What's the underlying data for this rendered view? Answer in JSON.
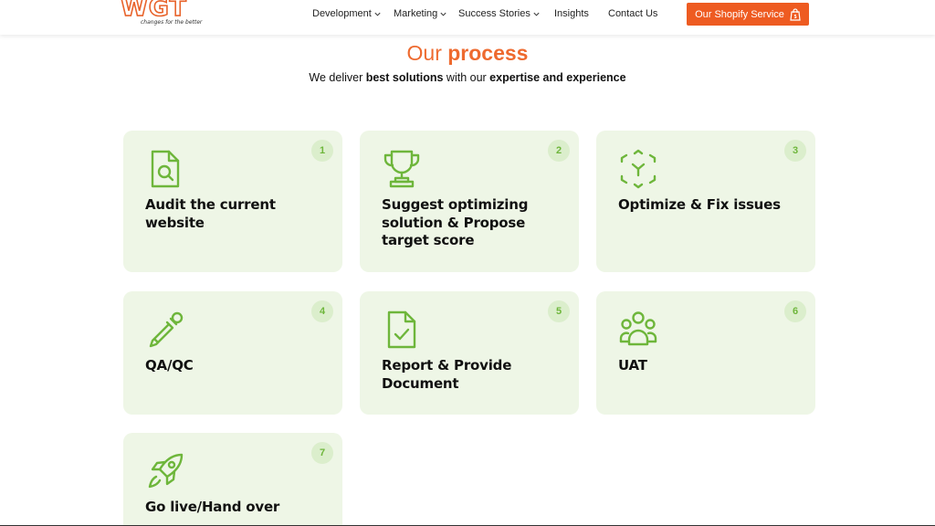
{
  "header": {
    "logo_text": "WGT",
    "logo_tagline": "changes for the better",
    "nav": [
      {
        "label": "Development",
        "has_dropdown": true
      },
      {
        "label": "Marketing",
        "has_dropdown": true
      },
      {
        "label": "Success Stories",
        "has_dropdown": true
      },
      {
        "label": "Insights",
        "has_dropdown": false
      },
      {
        "label": "Contact Us",
        "has_dropdown": false
      }
    ],
    "cta_label": "Our Shopify Service",
    "cta_icon": "shopify-bag-icon"
  },
  "section": {
    "title_light": "Our",
    "title_bold": "process",
    "subtitle_parts": [
      "We deliver ",
      "best solutions",
      " with our ",
      "expertise and experience"
    ]
  },
  "steps": [
    {
      "number": "1",
      "label": "Audit the current website",
      "icon": "file-search-icon"
    },
    {
      "number": "2",
      "label": "Suggest optimizing solution & Propose target score",
      "icon": "trophy-icon"
    },
    {
      "number": "3",
      "label": "Optimize & Fix issues",
      "icon": "arrows-converge-icon"
    },
    {
      "number": "4",
      "label": "QA/QC",
      "icon": "pipette-icon"
    },
    {
      "number": "5",
      "label": "Report & Provide Document",
      "icon": "file-check-icon"
    },
    {
      "number": "6",
      "label": "UAT",
      "icon": "users-icon"
    },
    {
      "number": "7",
      "label": "Go live/Hand over",
      "icon": "rocket-icon"
    }
  ],
  "colors": {
    "brand_orange": "#ee5b21",
    "title_orange": "#ee6a2f",
    "card_bg": "#eef6e6",
    "icon_green": "#6eb63b",
    "badge_bg": "#dbeecc"
  }
}
